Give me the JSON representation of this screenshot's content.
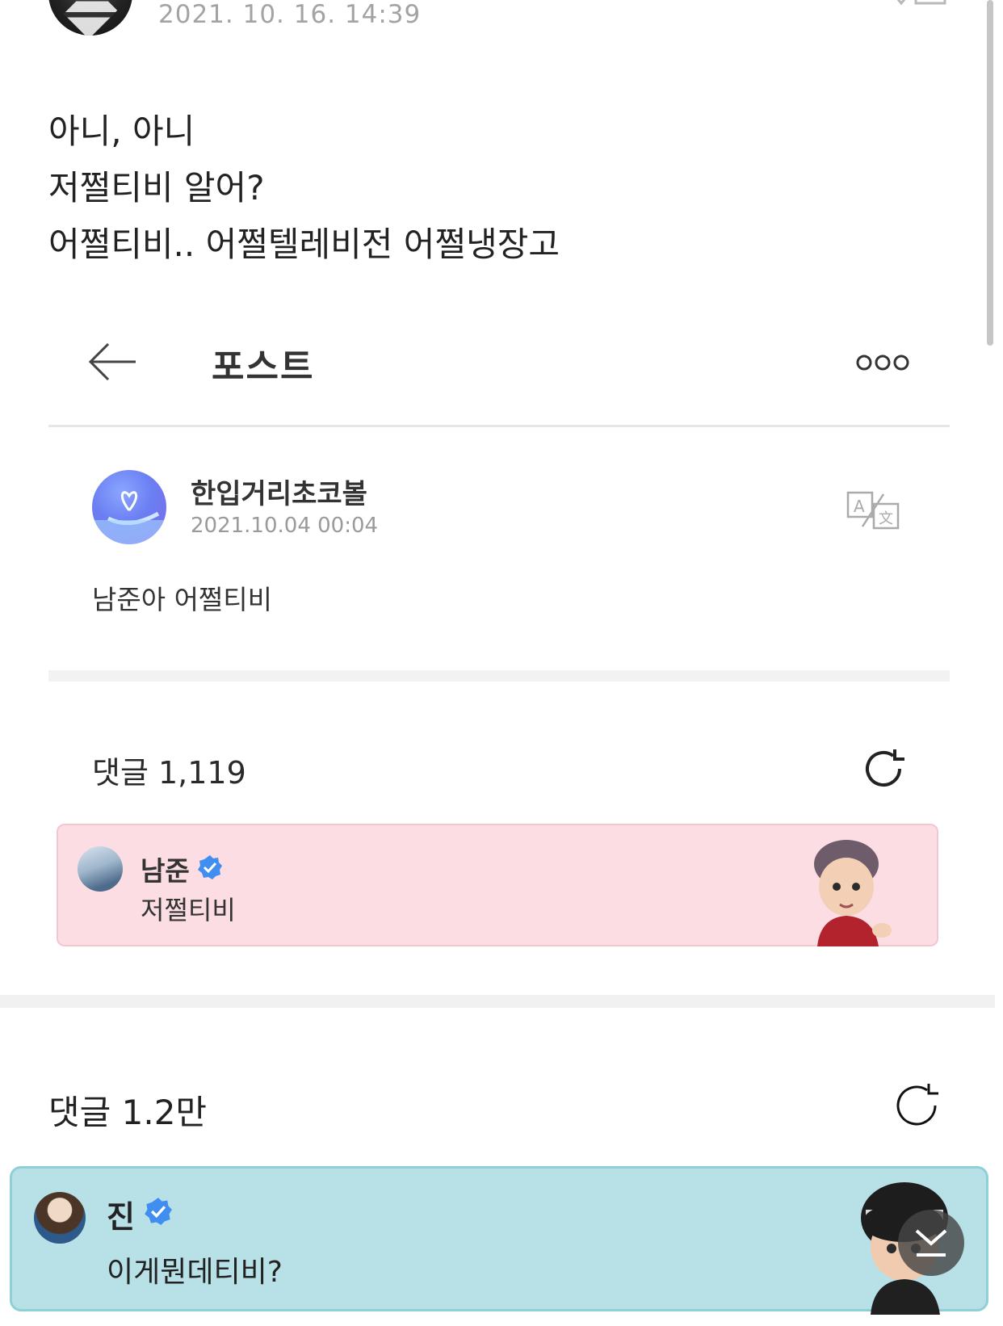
{
  "post": {
    "date": "2021. 10. 16. 14:39",
    "lines": [
      "아니, 아니",
      "저쩔티비 알어?",
      "어쩔티비.. 어쩔텔레비전 어쩔냉장고"
    ]
  },
  "embedded": {
    "header_title": "포스트",
    "author": "한입거리초코볼",
    "date": "2021.10.04 00:04",
    "content": "남준아 어쩔티비",
    "comments_label": "댓글 1,119",
    "top_comment": {
      "name": "남준",
      "text": "저쩔티비",
      "bg_color": "#fbdde3"
    }
  },
  "comments": {
    "label": "댓글 1.2만",
    "top_comment": {
      "name": "진",
      "text": "이게뭔데티비?",
      "bg_color": "#b7e1e6"
    }
  },
  "icons": {
    "back": "arrow-left-icon",
    "more": "more-dots-icon",
    "translate": "translate-icon",
    "refresh": "refresh-icon",
    "verified": "verified-badge-icon",
    "scroll_down": "chevron-double-down-icon"
  },
  "colors": {
    "verified": "#3f8ef0"
  }
}
